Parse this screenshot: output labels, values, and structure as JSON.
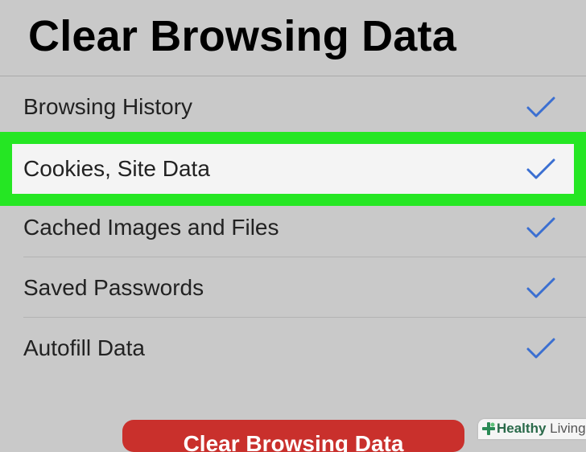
{
  "title": "Clear Browsing Data",
  "items": [
    {
      "label": "Browsing History",
      "checked": true
    },
    {
      "label": "Cookies, Site Data",
      "checked": true,
      "highlighted": true
    },
    {
      "label": "Cached Images and Files",
      "checked": true
    },
    {
      "label": "Saved Passwords",
      "checked": true
    },
    {
      "label": "Autofill Data",
      "checked": true
    }
  ],
  "action_button": {
    "label": "Clear Browsing Data"
  },
  "watermark": {
    "bold": "Healthy",
    "light": " Living"
  },
  "colors": {
    "background": "#c9c9c9",
    "highlight": "#25e623",
    "checkmark": "#3b6fd1",
    "button": "#c9302c"
  },
  "icons": {
    "check": "check-icon",
    "watermark": "plus-leaf-icon"
  }
}
